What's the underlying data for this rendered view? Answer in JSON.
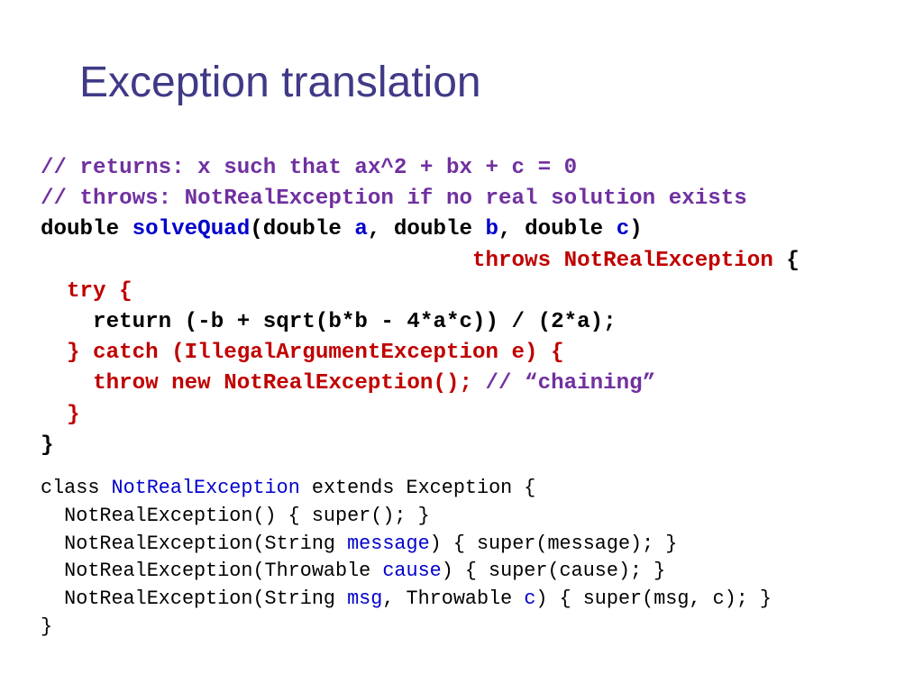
{
  "slide": {
    "title": "Exception translation"
  },
  "colors": {
    "title": "#3f3a87",
    "comment": "#7030a0",
    "keyword_red": "#c00000",
    "identifier_blue": "#0000cc",
    "code": "#000000"
  },
  "code_block_1": {
    "lines": [
      [
        {
          "t": "// returns: x such that ax^2 + bx + c = 0",
          "c": "cm"
        }
      ],
      [
        {
          "t": "// throws: NotRealException if no real solution exists",
          "c": "cm"
        }
      ],
      [
        {
          "t": "double ",
          "c": "k"
        },
        {
          "t": "solveQuad",
          "c": "b"
        },
        {
          "t": "(double ",
          "c": "k"
        },
        {
          "t": "a",
          "c": "b"
        },
        {
          "t": ", double ",
          "c": "k"
        },
        {
          "t": "b",
          "c": "b"
        },
        {
          "t": ", double ",
          "c": "k"
        },
        {
          "t": "c",
          "c": "b"
        },
        {
          "t": ")",
          "c": "k"
        }
      ],
      [
        {
          "t": "                                 ",
          "c": "k"
        },
        {
          "t": "throws NotRealException",
          "c": "r"
        },
        {
          "t": " {",
          "c": "k"
        }
      ],
      [
        {
          "t": "  ",
          "c": "k"
        },
        {
          "t": "try {",
          "c": "r"
        }
      ],
      [
        {
          "t": "    return (-b + sqrt(b*b - 4*a*c)) / (2*a);",
          "c": "k"
        }
      ],
      [
        {
          "t": "  ",
          "c": "k"
        },
        {
          "t": "} catch (IllegalArgumentException e) {",
          "c": "r"
        }
      ],
      [
        {
          "t": "    ",
          "c": "k"
        },
        {
          "t": "throw new NotRealException();",
          "c": "r"
        },
        {
          "t": " // “chaining”",
          "c": "cm"
        }
      ],
      [
        {
          "t": "  ",
          "c": "k"
        },
        {
          "t": "}",
          "c": "r"
        }
      ],
      [
        {
          "t": "}",
          "c": "k"
        }
      ]
    ]
  },
  "code_block_2": {
    "lines": [
      [
        {
          "t": "class ",
          "c": "k"
        },
        {
          "t": "NotRealException",
          "c": "b"
        },
        {
          "t": " extends Exception {",
          "c": "k"
        }
      ],
      [
        {
          "t": "  NotRealException() { super(); }",
          "c": "k"
        }
      ],
      [
        {
          "t": "  NotRealException(String ",
          "c": "k"
        },
        {
          "t": "message",
          "c": "b"
        },
        {
          "t": ") { super(message); }",
          "c": "k"
        }
      ],
      [
        {
          "t": "  NotRealException(Throwable ",
          "c": "k"
        },
        {
          "t": "cause",
          "c": "b"
        },
        {
          "t": ") { super(cause); }",
          "c": "k"
        }
      ],
      [
        {
          "t": "  NotRealException(String ",
          "c": "k"
        },
        {
          "t": "msg",
          "c": "b"
        },
        {
          "t": ", Throwable ",
          "c": "k"
        },
        {
          "t": "c",
          "c": "b"
        },
        {
          "t": ") { super(msg, c); }",
          "c": "k"
        }
      ],
      [
        {
          "t": "}",
          "c": "k"
        }
      ]
    ]
  }
}
